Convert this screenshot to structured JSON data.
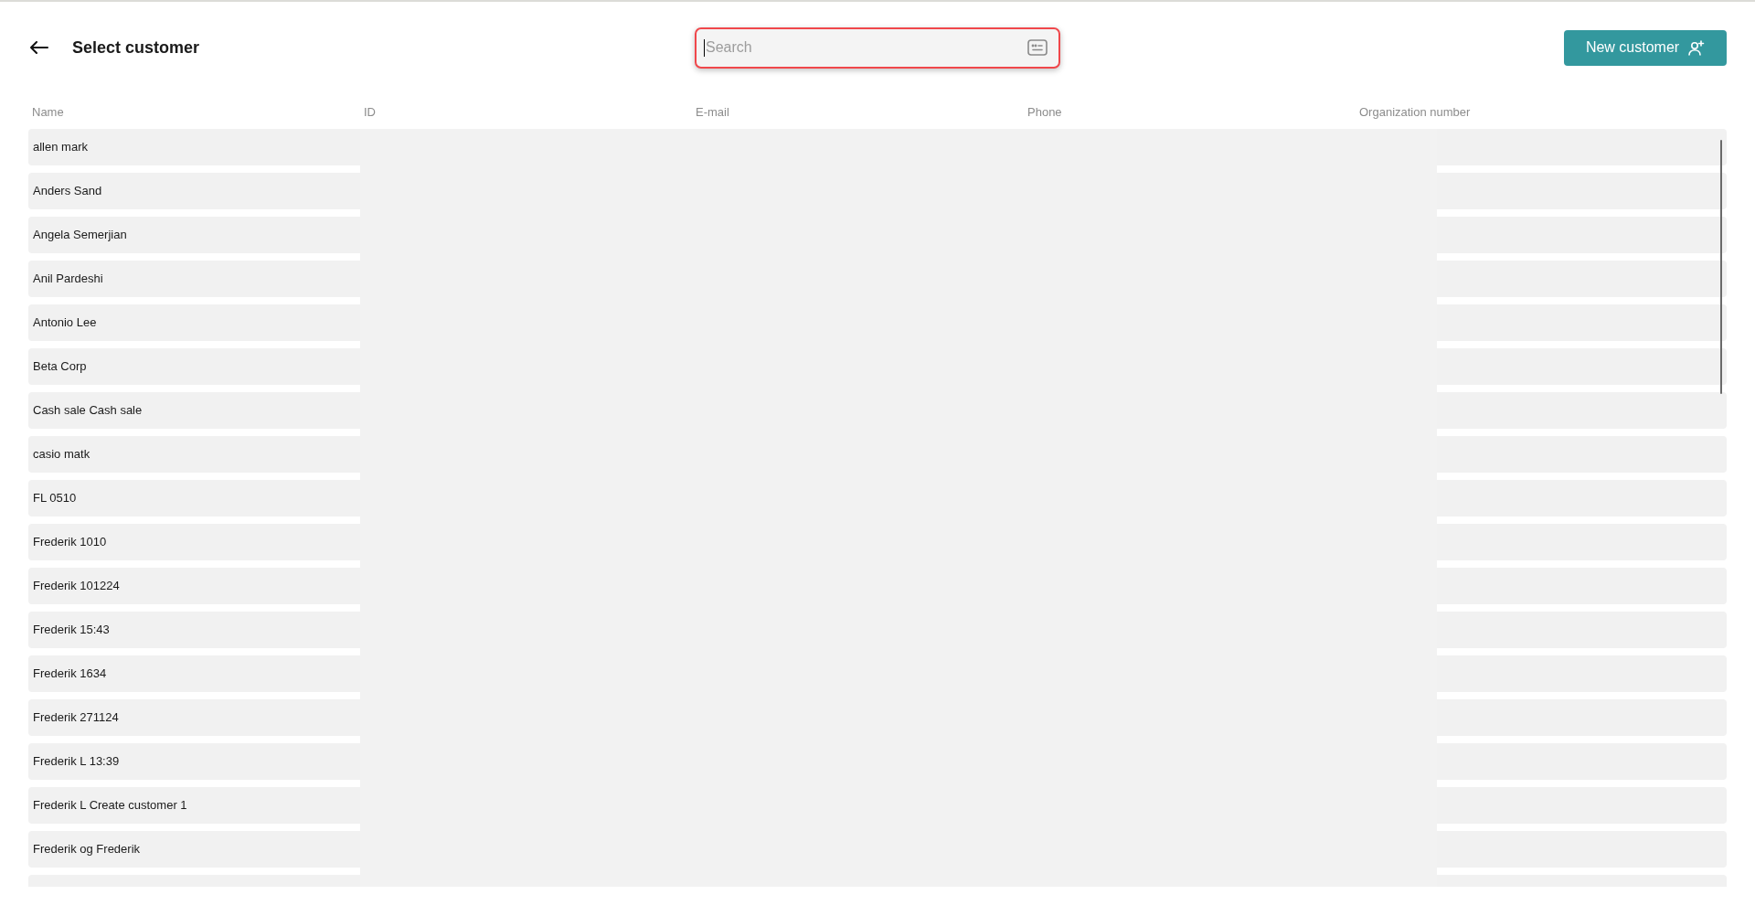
{
  "header": {
    "title": "Select customer"
  },
  "search": {
    "placeholder": "Search",
    "focused": true
  },
  "new_customer_button": {
    "label": "New customer"
  },
  "table": {
    "columns": [
      "Name",
      "ID",
      "E-mail",
      "Phone",
      "Organization number"
    ],
    "rows": [
      {
        "name": "allen mark"
      },
      {
        "name": "Anders Sand"
      },
      {
        "name": "Angela Semerjian"
      },
      {
        "name": "Anil Pardeshi"
      },
      {
        "name": "Antonio Lee"
      },
      {
        "name": "Beta Corp"
      },
      {
        "name": "Cash sale Cash sale"
      },
      {
        "name": "casio matk"
      },
      {
        "name": "FL 0510"
      },
      {
        "name": "Frederik 1010"
      },
      {
        "name": "Frederik 101224"
      },
      {
        "name": "Frederik 15:43"
      },
      {
        "name": "Frederik 1634"
      },
      {
        "name": "Frederik 271124"
      },
      {
        "name": "Frederik L 13:39"
      },
      {
        "name": "Frederik L Create customer 1"
      },
      {
        "name": "Frederik og Frederik"
      }
    ]
  }
}
